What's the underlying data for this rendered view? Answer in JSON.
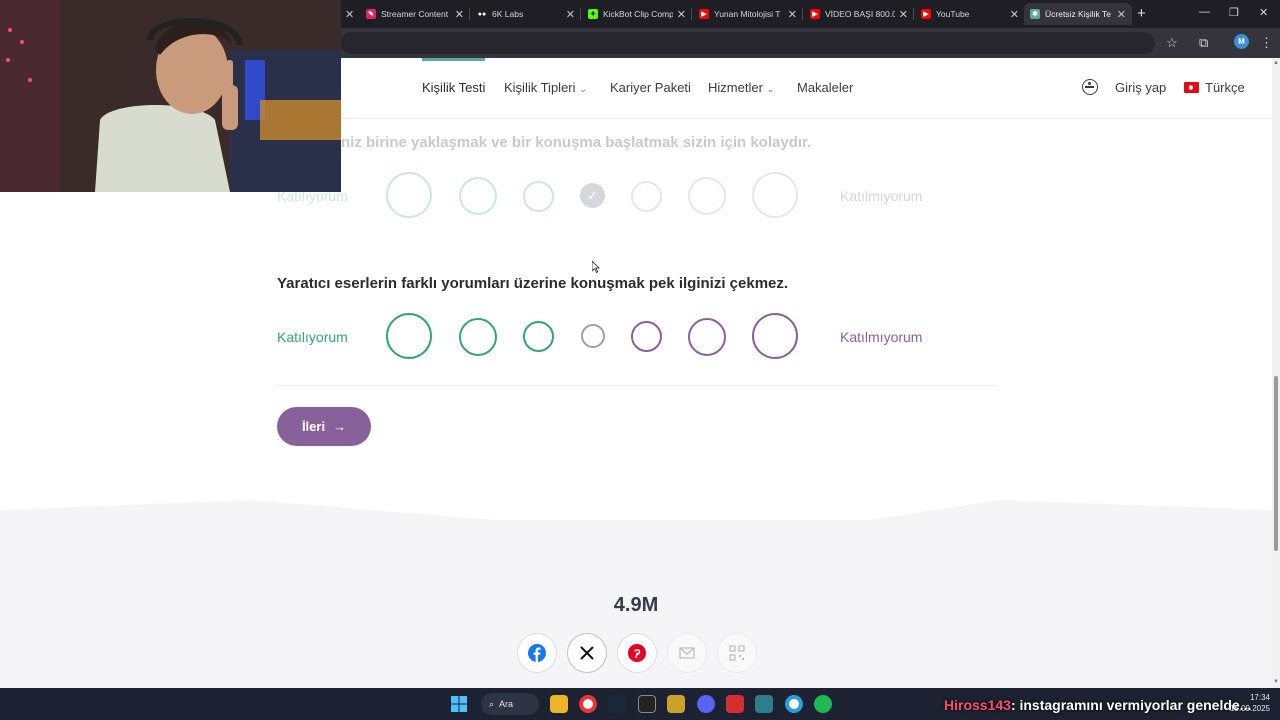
{
  "browser": {
    "tabs": [
      {
        "title": "Streamer Content",
        "favicon": "streamer-content-icon",
        "color": "#e2245b"
      },
      {
        "title": "6K Labs",
        "favicon": "6k-labs-icon",
        "color": "#ffffff"
      },
      {
        "title": "KickBot Clip Comp",
        "favicon": "kickbot-icon",
        "color": "#53fc18"
      },
      {
        "title": "Yunan Mitolojisi T",
        "favicon": "youtube-icon",
        "color": "#ff0000"
      },
      {
        "title": "VİDEO BAŞI 800.0",
        "favicon": "youtube-icon",
        "color": "#ff0000"
      },
      {
        "title": "YouTube",
        "favicon": "youtube-icon",
        "color": "#ff0000"
      },
      {
        "title": "Ücretsiz Kişilik Te",
        "favicon": "16personalities-icon",
        "color": "#5aa8a0",
        "active": true
      }
    ],
    "profile_initial": "M"
  },
  "nav": {
    "items": [
      {
        "label": "Kişilik Testi",
        "active": true
      },
      {
        "label": "Kişilik Tipleri",
        "dropdown": true
      },
      {
        "label": "Kariyer Paketi"
      },
      {
        "label": "Hizmetler",
        "dropdown": true
      },
      {
        "label": "Makaleler"
      }
    ],
    "login": "Giriş yap",
    "language": "Türkçe"
  },
  "questions": [
    {
      "text": "niz birine yaklaşmak ve bir konuşma başlatmak sizin için kolaydır.",
      "agree_label": "Katılıyorum",
      "disagree_label": "Katılmıyorum",
      "selected": 4,
      "answered": true
    },
    {
      "text": "Yaratıcı eserlerin farklı yorumları üzerine konuşmak pek ilginizi çekmez.",
      "agree_label": "Katılıyorum",
      "disagree_label": "Katılmıyorum",
      "selected": null,
      "answered": false
    }
  ],
  "next_button": "İleri",
  "share": {
    "count": "4.9M",
    "buttons": [
      "facebook-icon",
      "x-icon",
      "pinterest-icon",
      "email-icon",
      "qr-code-icon"
    ]
  },
  "colors": {
    "agree": "#33a474",
    "disagree": "#88619a",
    "neutral": "#9b9faa",
    "accent": "#88619a"
  },
  "taskbar": {
    "search_label": "Ara",
    "time": "17:34",
    "date": "15.09.2025"
  },
  "chat": {
    "user": "Hiross143",
    "message": ": instagramını vermiyorlar genelde..."
  }
}
